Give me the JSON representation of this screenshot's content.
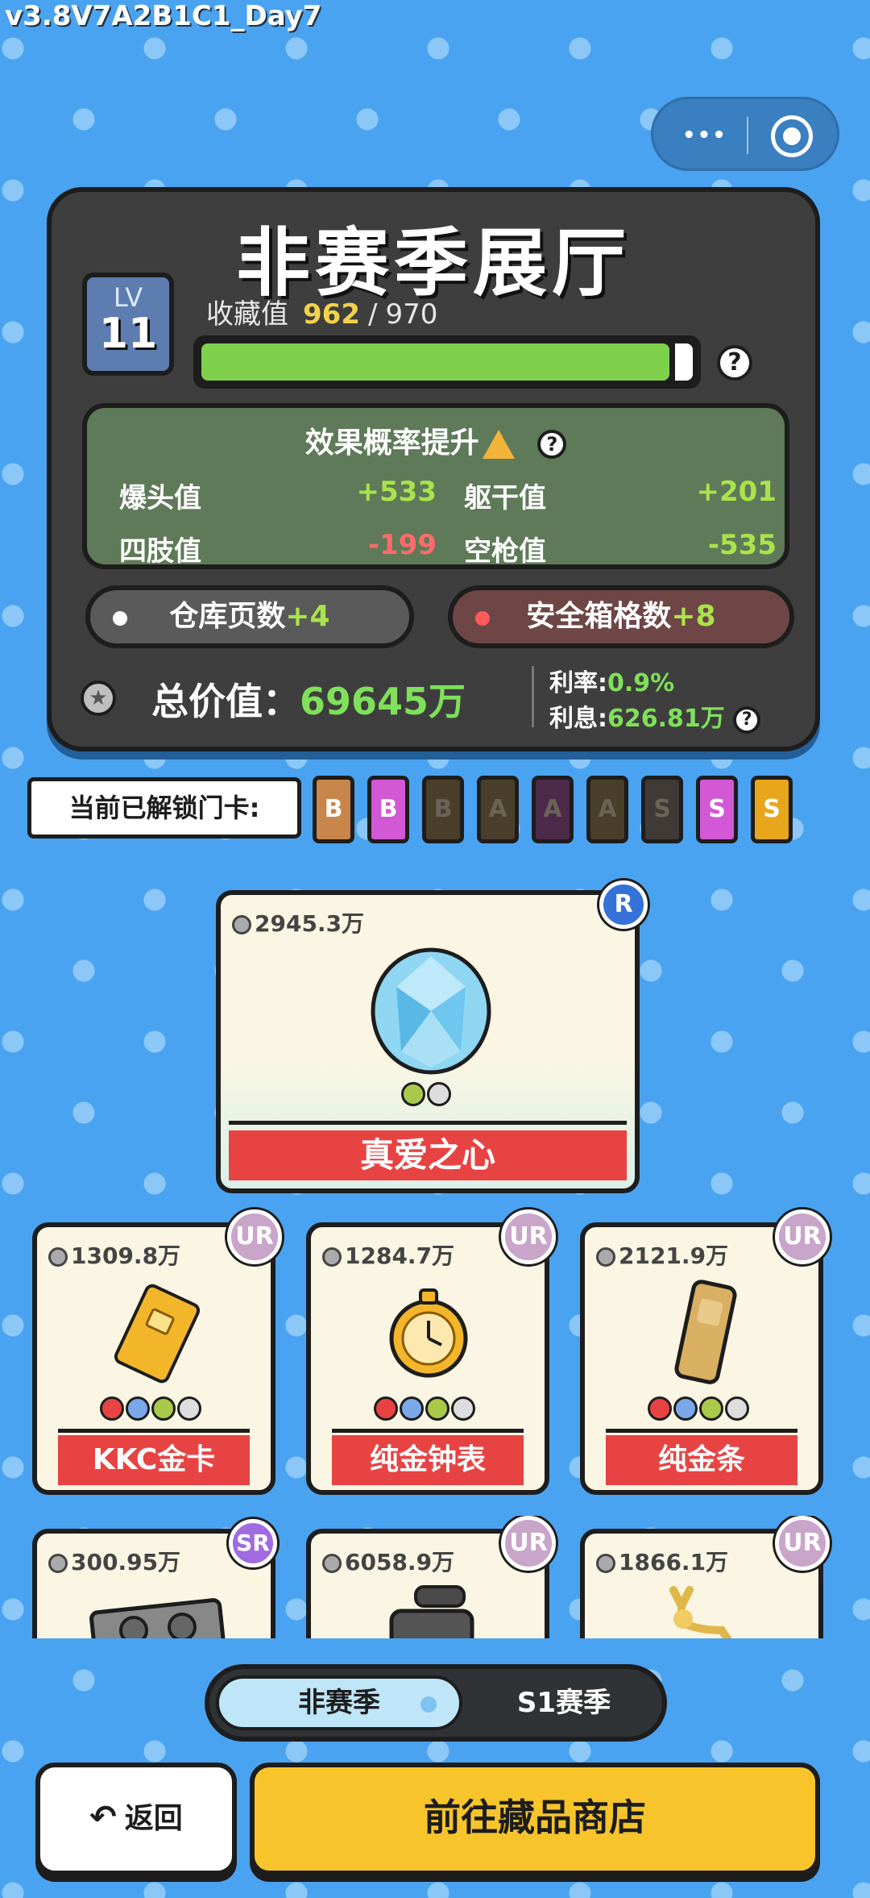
{
  "version": "v3.8V7A2B1C1_Day7",
  "capsule": {
    "more_icon": "more-dots-icon",
    "close_icon": "target-circle-icon",
    "dots": "•••"
  },
  "panel": {
    "title": "非赛季展厅",
    "level": {
      "label": "LV",
      "value": "11"
    },
    "collection": {
      "label": "收藏值",
      "current": "962",
      "sep": "/",
      "max": "970",
      "progress": 0.992
    },
    "help": "?",
    "effect": {
      "title": "效果概率提升",
      "stats": [
        {
          "label": "爆头值",
          "value": "+533"
        },
        {
          "label": "躯干值",
          "value": "+201"
        },
        {
          "label": "四肢值",
          "value": "-199"
        },
        {
          "label": "空枪值",
          "value": "-535"
        }
      ]
    },
    "warehouse": {
      "label": "仓库页数",
      "plus": "+4",
      "dot_color": "#ffffff"
    },
    "safebox": {
      "label": "安全箱格数",
      "plus": "+8",
      "dot_color": "#ff5a5a"
    },
    "total": {
      "label": "总价值：",
      "value": "69645万"
    },
    "rate": {
      "label": "利率:",
      "value": "0.9%"
    },
    "interest": {
      "label": "利息:",
      "value": "626.81万"
    }
  },
  "unlock": {
    "label": "当前已解锁门卡:",
    "tickets": [
      {
        "letter": "B",
        "color": "#c9864a",
        "unlocked": true
      },
      {
        "letter": "B",
        "color": "#d258d6",
        "unlocked": true
      },
      {
        "letter": "B",
        "color": "#4a3f2a",
        "unlocked": false
      },
      {
        "letter": "A",
        "color": "#4a3f2a",
        "unlocked": false
      },
      {
        "letter": "A",
        "color": "#4b2a4a",
        "unlocked": false
      },
      {
        "letter": "A",
        "color": "#4a3f2a",
        "unlocked": false
      },
      {
        "letter": "S",
        "color": "#3f3a35",
        "unlocked": false
      },
      {
        "letter": "S",
        "color": "#d258d6",
        "unlocked": true
      },
      {
        "letter": "S",
        "color": "#e8a61c",
        "unlocked": true
      }
    ]
  },
  "featured": {
    "price": "2945.3万",
    "name": "真爱之心",
    "rarity": "R",
    "icon": "diamond-heart-icon"
  },
  "items": [
    {
      "price": "1309.8万",
      "name": "KKC金卡",
      "rarity": "UR",
      "icon": "gold-card-icon"
    },
    {
      "price": "1284.7万",
      "name": "纯金钟表",
      "rarity": "UR",
      "icon": "gold-pocket-watch-icon"
    },
    {
      "price": "2121.9万",
      "name": "纯金条",
      "rarity": "UR",
      "icon": "gold-bar-icon"
    },
    {
      "price": "300.95万",
      "name": "",
      "rarity": "SR",
      "icon": "graphics-card-icon"
    },
    {
      "price": "6058.9万",
      "name": "",
      "rarity": "UR",
      "icon": "camera-icon"
    },
    {
      "price": "1866.1万",
      "name": "",
      "rarity": "UR",
      "icon": "golden-deer-icon"
    }
  ],
  "tabs": {
    "off_season": "非赛季",
    "s1": "S1赛季"
  },
  "buttons": {
    "back": "返回",
    "back_icon": "↶",
    "shop": "前往藏品商店"
  },
  "colors": {
    "accent": "#7fe05a",
    "gold": "#f3d24a",
    "red": "#e84343",
    "yellow": "#f7c52b",
    "bg": "#4aa3f0"
  }
}
